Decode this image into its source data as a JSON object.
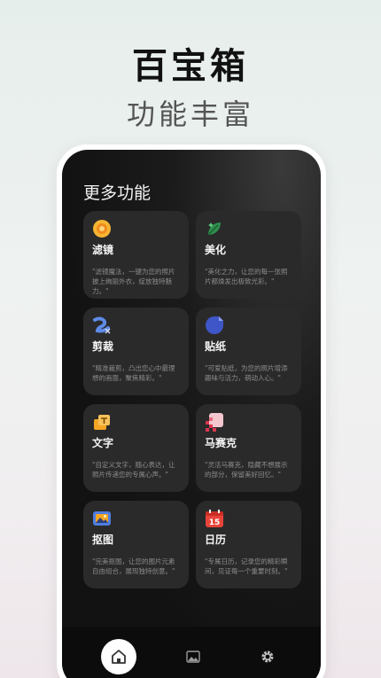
{
  "promo": {
    "title": "百宝箱",
    "subtitle": "功能丰富"
  },
  "screen": {
    "title": "更多功能"
  },
  "cards": [
    {
      "name": "滤镜",
      "desc": "\"滤镜魔法，一键为您的照片披上绚丽外衣，绽放独特魅力。\"",
      "icon": "orange-circle-icon"
    },
    {
      "name": "美化",
      "desc": "\"美化之力，让您的每一张照片都焕发出极致光彩。\"",
      "icon": "leaf-sparkle-icon"
    },
    {
      "name": "剪裁",
      "desc": "\"精准裁剪，凸出您心中最理想的画面，聚焦精彩。\"",
      "icon": "scissors-icon"
    },
    {
      "name": "贴纸",
      "desc": "\"可爱贴纸，为您的照片增添趣味与活力，萌动人心。\"",
      "icon": "sticker-icon"
    },
    {
      "name": "文字",
      "desc": "\"自定义文字，随心表达，让照片传递您的专属心声。\"",
      "icon": "text-icon"
    },
    {
      "name": "马赛克",
      "desc": "\"灵活马赛克，隐藏不想展示的部分，保留美好回忆。\"",
      "icon": "mosaic-icon"
    },
    {
      "name": "抠图",
      "desc": "\"完美抠图，让您的图片元素自由组合，展现独特创意。\"",
      "icon": "cutout-icon"
    },
    {
      "name": "日历",
      "desc": "\"专属日历，记录您的精彩瞬间，见证每一个重要时刻。\"",
      "icon": "calendar-icon",
      "day": "15"
    }
  ],
  "tabbar": {
    "items": [
      "home-icon",
      "image-icon",
      "settings-icon"
    ],
    "active": "home-icon"
  },
  "colors": {
    "accent_orange": "#f5a623",
    "card_bg": "#2a2a2a",
    "screen_bg": "#141414"
  }
}
